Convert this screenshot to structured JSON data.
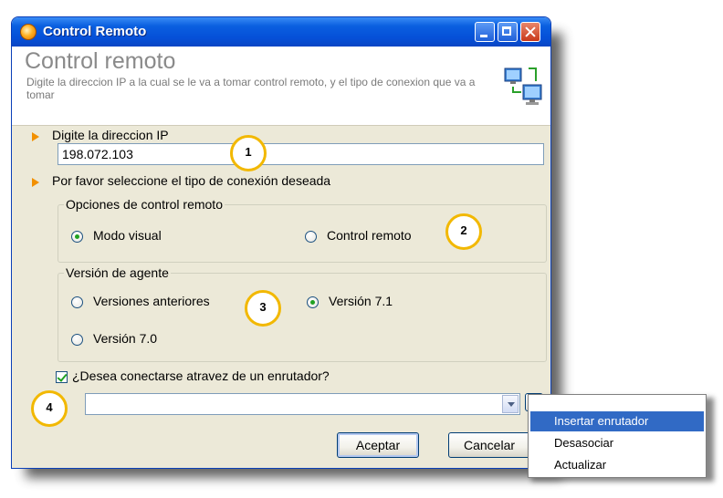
{
  "window": {
    "title": "Control Remoto"
  },
  "header": {
    "title": "Control remoto",
    "description": "Digite la direccion IP a la cual se le va a tomar control remoto, y el tipo de conexion que va a tomar"
  },
  "ip_section": {
    "label": "Digite la direccion IP",
    "value": "198.072.103"
  },
  "connection_prompt": "Por favor seleccione el tipo de conexión deseada",
  "remote_options": {
    "legend": "Opciones de control remoto",
    "options": [
      {
        "label": "Modo visual",
        "checked": true
      },
      {
        "label": "Control remoto",
        "checked": false
      }
    ]
  },
  "agent_version": {
    "legend": "Versión de agente",
    "options": [
      {
        "label": "Versiones anteriores",
        "checked": false
      },
      {
        "label": "Versión 7.1",
        "checked": true
      },
      {
        "label": "Versión 7.0",
        "checked": false
      }
    ]
  },
  "router": {
    "checkbox_label": "¿Desea conectarse atravez de un enrutador?",
    "checked": true,
    "selected_value": ""
  },
  "buttons": {
    "accept": "Aceptar",
    "cancel": "Cancelar"
  },
  "context_menu": {
    "items": [
      {
        "label": "Insertar enrutador",
        "highlighted": true
      },
      {
        "label": "Desasociar",
        "highlighted": false
      },
      {
        "label": "Actualizar",
        "highlighted": false
      }
    ]
  },
  "annotations": [
    "1",
    "2",
    "3",
    "4"
  ],
  "colors": {
    "titlebar": "#0550d8",
    "dialog_bg": "#ece9d8",
    "arrow_accent": "#f29000",
    "annotation_ring": "#f2b800",
    "menu_highlight": "#316ac5"
  }
}
